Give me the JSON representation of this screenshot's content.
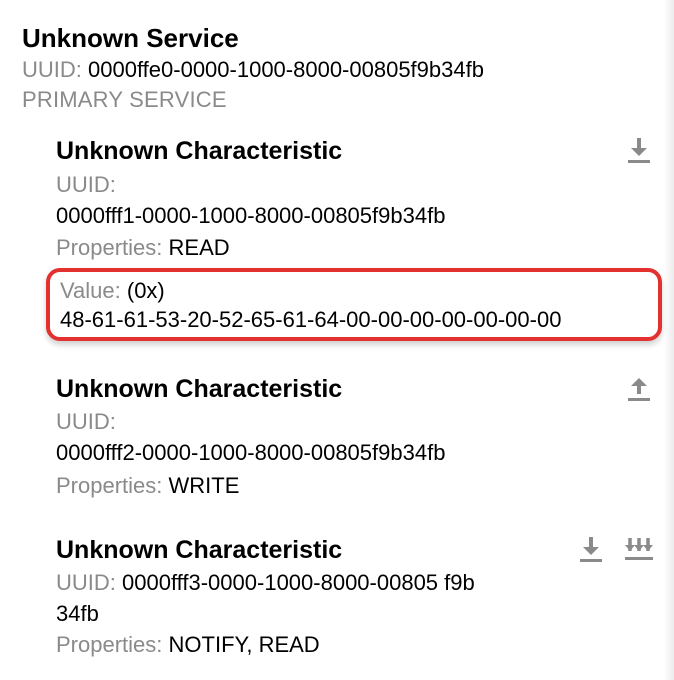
{
  "service": {
    "title": "Unknown Service",
    "uuid_label": "UUID:",
    "uuid": "0000ffe0-0000-1000-8000-00805f9b34fb",
    "primary_label": "PRIMARY SERVICE"
  },
  "characteristics": [
    {
      "title": "Unknown Characteristic",
      "uuid_label": "UUID:",
      "uuid": "0000fff1-0000-1000-8000-00805f9b34fb",
      "properties_label": "Properties:",
      "properties": "READ",
      "value_label": "Value:",
      "value_prefix": "(0x)",
      "value_hex": "48-61-61-53-20-52-65-61-64-00-00-00-00-00-00-00",
      "actions": [
        "download"
      ]
    },
    {
      "title": "Unknown Characteristic",
      "uuid_label": "UUID:",
      "uuid": "0000fff2-0000-1000-8000-00805f9b34fb",
      "properties_label": "Properties:",
      "properties": "WRITE",
      "actions": [
        "upload"
      ]
    },
    {
      "title": "Unknown Characteristic",
      "uuid_label": "UUID:",
      "uuid": "0000fff3-0000-1000-8000-00805 f9b34fb",
      "properties_label": "Properties:",
      "properties": "NOTIFY, READ",
      "actions": [
        "download",
        "notify"
      ]
    }
  ]
}
